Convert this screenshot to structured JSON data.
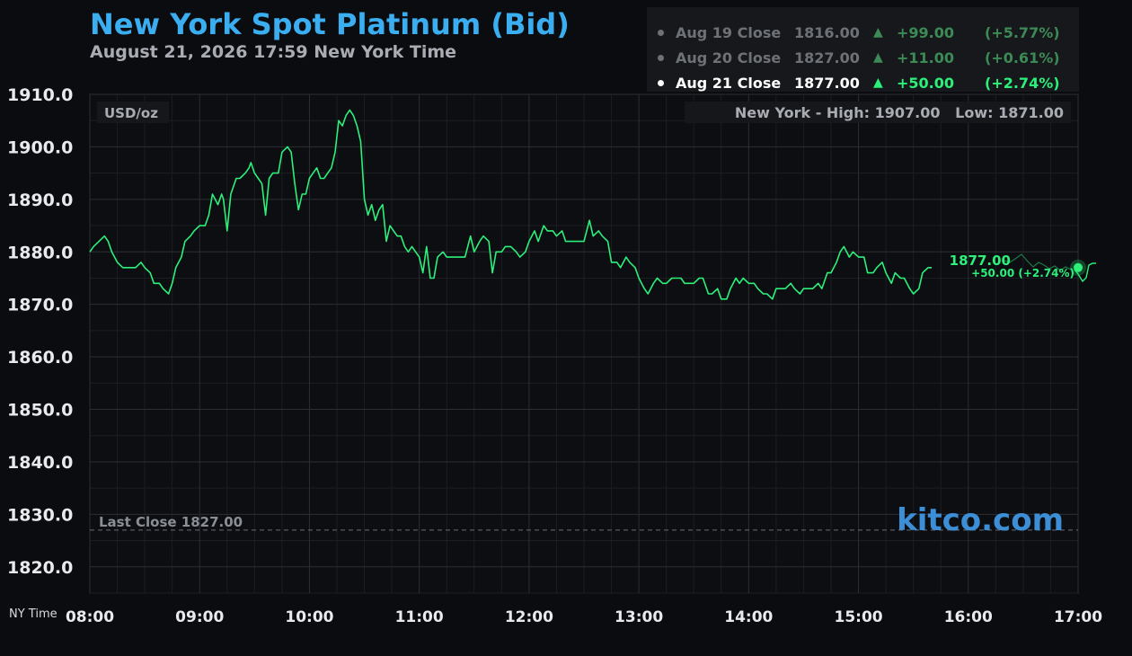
{
  "header": {
    "title": "New York Spot Platinum (Bid)",
    "subtitle": "August 21, 2026 17:59 New York Time"
  },
  "closes": [
    {
      "label": "Aug 19 Close",
      "value": "1816.00",
      "change": "+99.00",
      "pct": "(+5.77%)",
      "active": false
    },
    {
      "label": "Aug 20 Close",
      "value": "1827.00",
      "change": "+11.00",
      "pct": "(+0.61%)",
      "active": false
    },
    {
      "label": "Aug 21 Close",
      "value": "1877.00",
      "change": "+50.00",
      "pct": "(+2.74%)",
      "active": true
    }
  ],
  "colors": {
    "line": "#2cf07a",
    "title": "#3aaef0",
    "grid": "#2c2e33",
    "background": "#0b0c0f",
    "up_dim": "#3c8a55",
    "watermark": "#3c8fd6"
  },
  "chart_data": {
    "type": "line",
    "unit_label": "USD/oz",
    "high_low": "New York - High: 1907.00   Low: 1871.00",
    "last_close_label": "Last Close 1827.00",
    "last_close": 1827.0,
    "current_price": "1877.00",
    "current_change": "+50.00 (+2.74%)",
    "current_value": 1877.0,
    "watermark": "kitco.com",
    "x_axis_name": "NY Time",
    "ylim": [
      1815,
      1910
    ],
    "xlim": [
      "08:00",
      "17:00"
    ],
    "y_ticks": [
      1910,
      1900,
      1890,
      1880,
      1870,
      1860,
      1850,
      1840,
      1830,
      1820
    ],
    "y_tick_labels": [
      "1910.0",
      "1900.0",
      "1890.0",
      "1880.0",
      "1870.0",
      "1860.0",
      "1850.0",
      "1840.0",
      "1830.0",
      "1820.0"
    ],
    "x_ticks": [
      "08:00",
      "09:00",
      "10:00",
      "11:00",
      "12:00",
      "13:00",
      "14:00",
      "15:00",
      "16:00",
      "17:00"
    ],
    "grid": true,
    "series": [
      {
        "points": [
          [
            "08:00",
            1880
          ],
          [
            "08:02",
            1881
          ],
          [
            "08:05",
            1882
          ],
          [
            "08:08",
            1883
          ],
          [
            "08:10",
            1882
          ],
          [
            "08:12",
            1880
          ],
          [
            "08:15",
            1878
          ],
          [
            "08:18",
            1877
          ],
          [
            "08:20",
            1877
          ],
          [
            "08:23",
            1877
          ],
          [
            "08:25",
            1877
          ],
          [
            "08:28",
            1878
          ],
          [
            "08:30",
            1877
          ],
          [
            "08:33",
            1876
          ],
          [
            "08:35",
            1874
          ],
          [
            "08:38",
            1874
          ],
          [
            "08:40",
            1873
          ],
          [
            "08:43",
            1872
          ],
          [
            "08:45",
            1874
          ],
          [
            "08:47",
            1877
          ],
          [
            "08:50",
            1879
          ],
          [
            "08:52",
            1882
          ],
          [
            "08:55",
            1883
          ],
          [
            "08:57",
            1884
          ],
          [
            "09:00",
            1885
          ],
          [
            "09:03",
            1885
          ],
          [
            "09:05",
            1887
          ],
          [
            "09:07",
            1891
          ],
          [
            "09:10",
            1889
          ],
          [
            "09:12",
            1891
          ],
          [
            "09:13",
            1890
          ],
          [
            "09:15",
            1884
          ],
          [
            "09:17",
            1891
          ],
          [
            "09:20",
            1894
          ],
          [
            "09:22",
            1894
          ],
          [
            "09:25",
            1895
          ],
          [
            "09:27",
            1896
          ],
          [
            "09:28",
            1897
          ],
          [
            "09:30",
            1895
          ],
          [
            "09:32",
            1894
          ],
          [
            "09:34",
            1893
          ],
          [
            "09:36",
            1887
          ],
          [
            "09:38",
            1894
          ],
          [
            "09:40",
            1895
          ],
          [
            "09:43",
            1895
          ],
          [
            "09:45",
            1899
          ],
          [
            "09:48",
            1900
          ],
          [
            "09:50",
            1899
          ],
          [
            "09:52",
            1893
          ],
          [
            "09:54",
            1888
          ],
          [
            "09:56",
            1891
          ],
          [
            "09:58",
            1891
          ],
          [
            "10:00",
            1894
          ],
          [
            "10:02",
            1895
          ],
          [
            "10:04",
            1896
          ],
          [
            "10:06",
            1894
          ],
          [
            "10:08",
            1894
          ],
          [
            "10:10",
            1895
          ],
          [
            "10:12",
            1896
          ],
          [
            "10:14",
            1899
          ],
          [
            "10:16",
            1905
          ],
          [
            "10:18",
            1904
          ],
          [
            "10:20",
            1906
          ],
          [
            "10:22",
            1907
          ],
          [
            "10:24",
            1906
          ],
          [
            "10:26",
            1904
          ],
          [
            "10:28",
            1901
          ],
          [
            "10:30",
            1890
          ],
          [
            "10:32",
            1887
          ],
          [
            "10:34",
            1889
          ],
          [
            "10:36",
            1886
          ],
          [
            "10:38",
            1888
          ],
          [
            "10:40",
            1889
          ],
          [
            "10:42",
            1882
          ],
          [
            "10:44",
            1885
          ],
          [
            "10:46",
            1884
          ],
          [
            "10:48",
            1883
          ],
          [
            "10:50",
            1883
          ],
          [
            "10:52",
            1881
          ],
          [
            "10:54",
            1880
          ],
          [
            "10:56",
            1881
          ],
          [
            "10:58",
            1880
          ],
          [
            "11:00",
            1879
          ],
          [
            "11:02",
            1876
          ],
          [
            "11:04",
            1881
          ],
          [
            "11:06",
            1875
          ],
          [
            "11:08",
            1875
          ],
          [
            "11:10",
            1879
          ],
          [
            "11:13",
            1880
          ],
          [
            "11:15",
            1879
          ],
          [
            "11:20",
            1879
          ],
          [
            "11:25",
            1879
          ],
          [
            "11:28",
            1883
          ],
          [
            "11:30",
            1880
          ],
          [
            "11:33",
            1882
          ],
          [
            "11:35",
            1883
          ],
          [
            "11:38",
            1882
          ],
          [
            "11:40",
            1876
          ],
          [
            "11:42",
            1880
          ],
          [
            "11:45",
            1880
          ],
          [
            "11:47",
            1881
          ],
          [
            "11:50",
            1881
          ],
          [
            "11:53",
            1880
          ],
          [
            "11:55",
            1879
          ],
          [
            "11:58",
            1880
          ],
          [
            "12:00",
            1882
          ],
          [
            "12:03",
            1884
          ],
          [
            "12:05",
            1882
          ],
          [
            "12:08",
            1885
          ],
          [
            "12:10",
            1884
          ],
          [
            "12:13",
            1884
          ],
          [
            "12:15",
            1883
          ],
          [
            "12:18",
            1884
          ],
          [
            "12:20",
            1882
          ],
          [
            "12:25",
            1882
          ],
          [
            "12:30",
            1882
          ],
          [
            "12:33",
            1886
          ],
          [
            "12:35",
            1883
          ],
          [
            "12:38",
            1884
          ],
          [
            "12:40",
            1883
          ],
          [
            "12:43",
            1882
          ],
          [
            "12:45",
            1878
          ],
          [
            "12:48",
            1878
          ],
          [
            "12:50",
            1877
          ],
          [
            "12:53",
            1879
          ],
          [
            "12:55",
            1878
          ],
          [
            "12:58",
            1877
          ],
          [
            "13:00",
            1875
          ],
          [
            "13:03",
            1873
          ],
          [
            "13:05",
            1872
          ],
          [
            "13:08",
            1874
          ],
          [
            "13:10",
            1875
          ],
          [
            "13:13",
            1874
          ],
          [
            "13:15",
            1874
          ],
          [
            "13:18",
            1875
          ],
          [
            "13:23",
            1875
          ],
          [
            "13:25",
            1874
          ],
          [
            "13:30",
            1874
          ],
          [
            "13:33",
            1875
          ],
          [
            "13:35",
            1875
          ],
          [
            "13:38",
            1872
          ],
          [
            "13:40",
            1872
          ],
          [
            "13:43",
            1873
          ],
          [
            "13:45",
            1871
          ],
          [
            "13:48",
            1871
          ],
          [
            "13:50",
            1873
          ],
          [
            "13:53",
            1875
          ],
          [
            "13:55",
            1874
          ],
          [
            "13:57",
            1875
          ],
          [
            "14:00",
            1874
          ],
          [
            "14:03",
            1874
          ],
          [
            "14:05",
            1873
          ],
          [
            "14:08",
            1872
          ],
          [
            "14:10",
            1872
          ],
          [
            "14:13",
            1871
          ],
          [
            "14:15",
            1873
          ],
          [
            "14:18",
            1873
          ],
          [
            "14:20",
            1873
          ],
          [
            "14:23",
            1874
          ],
          [
            "14:25",
            1873
          ],
          [
            "14:28",
            1872
          ],
          [
            "14:30",
            1873
          ],
          [
            "14:33",
            1873
          ],
          [
            "14:35",
            1873
          ],
          [
            "14:38",
            1874
          ],
          [
            "14:40",
            1873
          ],
          [
            "14:43",
            1876
          ],
          [
            "14:45",
            1876
          ],
          [
            "14:48",
            1878
          ],
          [
            "14:50",
            1880
          ],
          [
            "14:52",
            1881
          ],
          [
            "14:55",
            1879
          ],
          [
            "14:57",
            1880
          ],
          [
            "15:00",
            1879
          ],
          [
            "15:03",
            1879
          ],
          [
            "15:05",
            1876
          ],
          [
            "15:08",
            1876
          ],
          [
            "15:10",
            1877
          ],
          [
            "15:13",
            1878
          ],
          [
            "15:15",
            1876
          ],
          [
            "15:18",
            1874
          ],
          [
            "15:20",
            1876
          ],
          [
            "15:23",
            1875
          ],
          [
            "15:25",
            1875
          ],
          [
            "15:28",
            1873
          ],
          [
            "15:30",
            1872
          ],
          [
            "15:33",
            1873
          ],
          [
            "15:35",
            1876
          ],
          [
            "15:38",
            1877
          ],
          [
            "15:40",
            1877
          ]
        ]
      }
    ]
  }
}
